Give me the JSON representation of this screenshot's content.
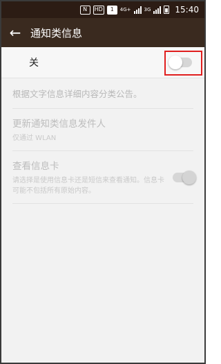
{
  "status_bar": {
    "icons": [
      "nfc-icon",
      "hd-icon",
      "sim-icon",
      "4g-signal-icon",
      "3g-signal-icon",
      "battery-icon"
    ],
    "nfc_label": "N",
    "hd_label": "HD",
    "sim_label": "1",
    "net1": "4G+",
    "net2": "3G",
    "time": "15:40"
  },
  "app_bar": {
    "back_icon": "arrow-left-icon",
    "title": "通知类信息"
  },
  "master_switch": {
    "label": "关",
    "state": "off"
  },
  "description": "根据文字信息详细内容分类公告。",
  "sender_update": {
    "title": "更新通知类信息发件人",
    "subtitle": "仅通过 WLAN"
  },
  "info_card": {
    "title": "查看信息卡",
    "subtitle": "请选择是使用信息卡还是短信来查看通知。信息卡可能不包括所有原始内容。",
    "state": "on"
  },
  "colors": {
    "app_bar": "#3a2a1f",
    "status_bar": "#2c1c14",
    "highlight": "#e01e1e"
  }
}
